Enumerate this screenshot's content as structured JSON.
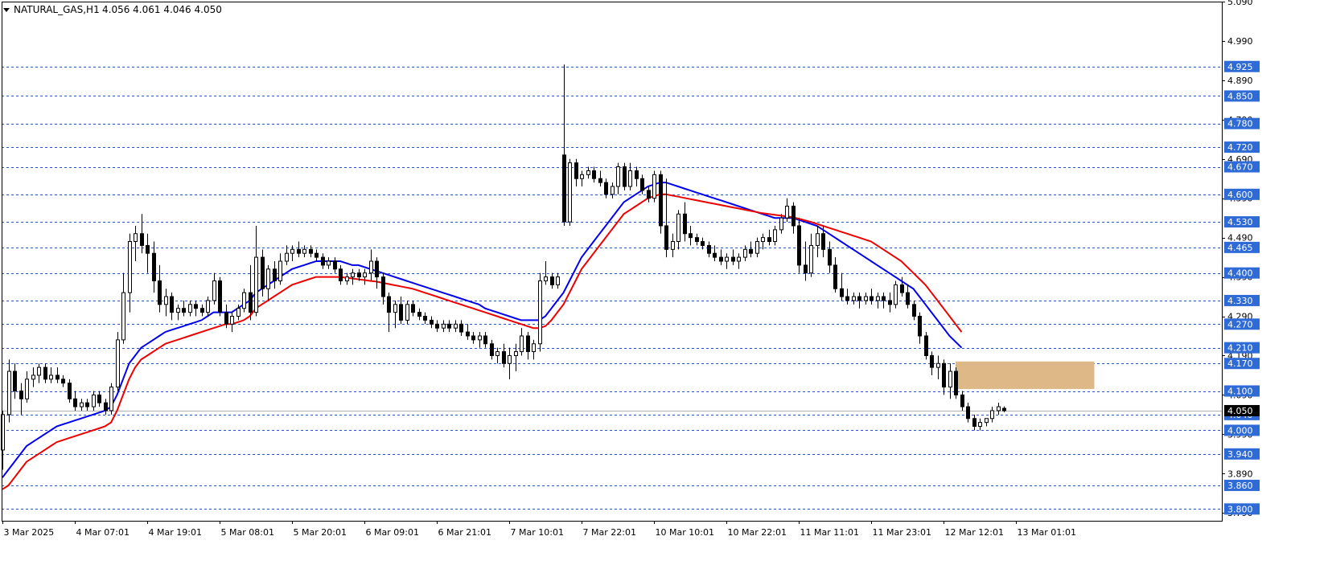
{
  "header": {
    "symbol_info": "NATURAL_GAS,H1",
    "ohlc": "4.056 4.061 4.046 4.050"
  },
  "colors": {
    "ema_fast": "#0000ee",
    "ema_slow": "#ee0000",
    "level_line": "#2e53b8",
    "level_label_bg": "#2e6bd6",
    "zone_fill": "#deb887",
    "current_price_label_bg": "#000000"
  },
  "chart_data": {
    "type": "candlestick",
    "ylim": [
      3.77,
      5.09
    ],
    "y_tick_labels": [
      "5.090",
      "4.990",
      "4.890",
      "4.790",
      "4.690",
      "4.590",
      "4.490",
      "4.390",
      "4.290",
      "4.190",
      "4.090",
      "3.990",
      "3.890",
      "3.790"
    ],
    "x_tick_labels": [
      {
        "bar": 0,
        "label": "3 Mar 2025"
      },
      {
        "bar": 12,
        "label": "4 Mar 07:01"
      },
      {
        "bar": 24,
        "label": "4 Mar 19:01"
      },
      {
        "bar": 36,
        "label": "5 Mar 08:01"
      },
      {
        "bar": 48,
        "label": "5 Mar 20:01"
      },
      {
        "bar": 60,
        "label": "6 Mar 09:01"
      },
      {
        "bar": 72,
        "label": "6 Mar 21:01"
      },
      {
        "bar": 84,
        "label": "7 Mar 10:01"
      },
      {
        "bar": 96,
        "label": "7 Mar 22:01"
      },
      {
        "bar": 108,
        "label": "10 Mar 10:01"
      },
      {
        "bar": 120,
        "label": "10 Mar 22:01"
      },
      {
        "bar": 132,
        "label": "11 Mar 11:01"
      },
      {
        "bar": 144,
        "label": "11 Mar 23:01"
      },
      {
        "bar": 156,
        "label": "12 Mar 12:01"
      },
      {
        "bar": 168,
        "label": "13 Mar 01:01"
      }
    ],
    "horizontal_levels": [
      4.925,
      4.85,
      4.78,
      4.72,
      4.67,
      4.6,
      4.53,
      4.465,
      4.4,
      4.33,
      4.27,
      4.21,
      4.17,
      4.1,
      4.04,
      4.0,
      3.94,
      3.86,
      3.8
    ],
    "current_price": 4.05,
    "current_price_label": "4.050",
    "zone": {
      "price_low": 4.105,
      "price_high": 4.175,
      "bar_start": 158,
      "bar_end": 181
    },
    "ohlc": [
      [
        3.95,
        4.05,
        3.9,
        4.04
      ],
      [
        4.04,
        4.18,
        4.02,
        4.15
      ],
      [
        4.15,
        4.17,
        4.08,
        4.1
      ],
      [
        4.1,
        4.12,
        4.04,
        4.08
      ],
      [
        4.08,
        4.15,
        4.07,
        4.13
      ],
      [
        4.13,
        4.16,
        4.11,
        4.14
      ],
      [
        4.14,
        4.17,
        4.12,
        4.16
      ],
      [
        4.16,
        4.17,
        4.12,
        4.13
      ],
      [
        4.13,
        4.16,
        4.12,
        4.14
      ],
      [
        4.14,
        4.16,
        4.12,
        4.13
      ],
      [
        4.13,
        4.14,
        4.11,
        4.12
      ],
      [
        4.12,
        4.13,
        4.07,
        4.08
      ],
      [
        4.08,
        4.1,
        4.05,
        4.06
      ],
      [
        4.06,
        4.08,
        4.05,
        4.07
      ],
      [
        4.07,
        4.08,
        4.05,
        4.06
      ],
      [
        4.06,
        4.1,
        4.05,
        4.09
      ],
      [
        4.09,
        4.1,
        4.06,
        4.07
      ],
      [
        4.07,
        4.08,
        4.04,
        4.05
      ],
      [
        4.05,
        4.12,
        4.04,
        4.11
      ],
      [
        4.11,
        4.25,
        4.1,
        4.23
      ],
      [
        4.23,
        4.4,
        4.22,
        4.35
      ],
      [
        4.35,
        4.5,
        4.3,
        4.48
      ],
      [
        4.48,
        4.52,
        4.43,
        4.5
      ],
      [
        4.5,
        4.55,
        4.45,
        4.47
      ],
      [
        4.47,
        4.5,
        4.4,
        4.45
      ],
      [
        4.45,
        4.48,
        4.35,
        4.38
      ],
      [
        4.38,
        4.42,
        4.3,
        4.32
      ],
      [
        4.32,
        4.36,
        4.29,
        4.34
      ],
      [
        4.34,
        4.35,
        4.28,
        4.3
      ],
      [
        4.3,
        4.32,
        4.28,
        4.31
      ],
      [
        4.31,
        4.33,
        4.29,
        4.3
      ],
      [
        4.3,
        4.33,
        4.29,
        4.32
      ],
      [
        4.32,
        4.33,
        4.29,
        4.31
      ],
      [
        4.31,
        4.32,
        4.29,
        4.3
      ],
      [
        4.3,
        4.34,
        4.29,
        4.33
      ],
      [
        4.33,
        4.4,
        4.32,
        4.38
      ],
      [
        4.38,
        4.39,
        4.29,
        4.3
      ],
      [
        4.3,
        4.32,
        4.26,
        4.27
      ],
      [
        4.27,
        4.3,
        4.25,
        4.29
      ],
      [
        4.29,
        4.32,
        4.28,
        4.31
      ],
      [
        4.31,
        4.36,
        4.3,
        4.35
      ],
      [
        4.35,
        4.42,
        4.28,
        4.3
      ],
      [
        4.3,
        4.52,
        4.29,
        4.44
      ],
      [
        4.44,
        4.46,
        4.34,
        4.36
      ],
      [
        4.36,
        4.42,
        4.33,
        4.41
      ],
      [
        4.41,
        4.43,
        4.36,
        4.38
      ],
      [
        4.38,
        4.45,
        4.37,
        4.43
      ],
      [
        4.43,
        4.47,
        4.42,
        4.45
      ],
      [
        4.45,
        4.47,
        4.43,
        4.46
      ],
      [
        4.46,
        4.48,
        4.44,
        4.45
      ],
      [
        4.45,
        4.47,
        4.44,
        4.46
      ],
      [
        4.46,
        4.47,
        4.44,
        4.45
      ],
      [
        4.45,
        4.46,
        4.43,
        4.44
      ],
      [
        4.44,
        4.45,
        4.41,
        4.42
      ],
      [
        4.42,
        4.44,
        4.41,
        4.43
      ],
      [
        4.43,
        4.44,
        4.4,
        4.41
      ],
      [
        4.41,
        4.42,
        4.37,
        4.38
      ],
      [
        4.38,
        4.4,
        4.37,
        4.39
      ],
      [
        4.39,
        4.41,
        4.37,
        4.4
      ],
      [
        4.4,
        4.41,
        4.38,
        4.39
      ],
      [
        4.39,
        4.41,
        4.37,
        4.4
      ],
      [
        4.4,
        4.46,
        4.38,
        4.43
      ],
      [
        4.43,
        4.44,
        4.36,
        4.39
      ],
      [
        4.39,
        4.4,
        4.32,
        4.34
      ],
      [
        4.34,
        4.35,
        4.25,
        4.3
      ],
      [
        4.3,
        4.33,
        4.26,
        4.32
      ],
      [
        4.32,
        4.34,
        4.27,
        4.28
      ],
      [
        4.28,
        4.33,
        4.27,
        4.32
      ],
      [
        4.32,
        4.33,
        4.29,
        4.3
      ],
      [
        4.3,
        4.31,
        4.28,
        4.29
      ],
      [
        4.29,
        4.3,
        4.27,
        4.28
      ],
      [
        4.28,
        4.29,
        4.26,
        4.27
      ],
      [
        4.27,
        4.28,
        4.25,
        4.26
      ],
      [
        4.26,
        4.28,
        4.25,
        4.27
      ],
      [
        4.27,
        4.28,
        4.25,
        4.26
      ],
      [
        4.26,
        4.28,
        4.25,
        4.27
      ],
      [
        4.27,
        4.28,
        4.24,
        4.25
      ],
      [
        4.25,
        4.27,
        4.23,
        4.24
      ],
      [
        4.24,
        4.25,
        4.22,
        4.23
      ],
      [
        4.23,
        4.25,
        4.21,
        4.24
      ],
      [
        4.24,
        4.25,
        4.21,
        4.22
      ],
      [
        4.22,
        4.23,
        4.18,
        4.19
      ],
      [
        4.19,
        4.21,
        4.17,
        4.2
      ],
      [
        4.2,
        4.22,
        4.16,
        4.17
      ],
      [
        4.17,
        4.21,
        4.13,
        4.19
      ],
      [
        4.19,
        4.22,
        4.15,
        4.2
      ],
      [
        4.2,
        4.26,
        4.19,
        4.24
      ],
      [
        4.24,
        4.25,
        4.18,
        4.2
      ],
      [
        4.2,
        4.23,
        4.18,
        4.22
      ],
      [
        4.22,
        4.4,
        4.2,
        4.38
      ],
      [
        4.38,
        4.43,
        4.37,
        4.39
      ],
      [
        4.39,
        4.4,
        4.36,
        4.37
      ],
      [
        4.37,
        4.4,
        4.36,
        4.39
      ],
      [
        4.7,
        4.93,
        4.52,
        4.53
      ],
      [
        4.53,
        4.69,
        4.52,
        4.68
      ],
      [
        4.68,
        4.69,
        4.62,
        4.64
      ],
      [
        4.64,
        4.66,
        4.62,
        4.65
      ],
      [
        4.65,
        4.67,
        4.64,
        4.66
      ],
      [
        4.66,
        4.67,
        4.63,
        4.64
      ],
      [
        4.64,
        4.66,
        4.62,
        4.63
      ],
      [
        4.63,
        4.64,
        4.59,
        4.6
      ],
      [
        4.6,
        4.63,
        4.59,
        4.62
      ],
      [
        4.62,
        4.68,
        4.6,
        4.67
      ],
      [
        4.67,
        4.68,
        4.61,
        4.62
      ],
      [
        4.62,
        4.68,
        4.61,
        4.66
      ],
      [
        4.66,
        4.67,
        4.62,
        4.64
      ],
      [
        4.64,
        4.65,
        4.6,
        4.61
      ],
      [
        4.61,
        4.62,
        4.58,
        4.59
      ],
      [
        4.59,
        4.66,
        4.58,
        4.65
      ],
      [
        4.65,
        4.66,
        4.5,
        4.52
      ],
      [
        4.52,
        4.64,
        4.44,
        4.46
      ],
      [
        4.46,
        4.5,
        4.44,
        4.48
      ],
      [
        4.48,
        4.56,
        4.46,
        4.55
      ],
      [
        4.55,
        4.58,
        4.48,
        4.5
      ],
      [
        4.5,
        4.52,
        4.47,
        4.49
      ],
      [
        4.49,
        4.5,
        4.47,
        4.48
      ],
      [
        4.48,
        4.49,
        4.46,
        4.47
      ],
      [
        4.47,
        4.48,
        4.44,
        4.45
      ],
      [
        4.45,
        4.47,
        4.43,
        4.44
      ],
      [
        4.44,
        4.46,
        4.42,
        4.43
      ],
      [
        4.43,
        4.45,
        4.41,
        4.44
      ],
      [
        4.44,
        4.46,
        4.42,
        4.43
      ],
      [
        4.43,
        4.45,
        4.41,
        4.44
      ],
      [
        4.44,
        4.47,
        4.43,
        4.46
      ],
      [
        4.46,
        4.48,
        4.44,
        4.45
      ],
      [
        4.45,
        4.49,
        4.44,
        4.48
      ],
      [
        4.48,
        4.5,
        4.46,
        4.49
      ],
      [
        4.49,
        4.51,
        4.47,
        4.48
      ],
      [
        4.48,
        4.52,
        4.47,
        4.51
      ],
      [
        4.51,
        4.55,
        4.5,
        4.54
      ],
      [
        4.54,
        4.59,
        4.53,
        4.57
      ],
      [
        4.57,
        4.58,
        4.5,
        4.52
      ],
      [
        4.52,
        4.54,
        4.4,
        4.42
      ],
      [
        4.42,
        4.48,
        4.38,
        4.4
      ],
      [
        4.4,
        4.5,
        4.39,
        4.47
      ],
      [
        4.47,
        4.52,
        4.44,
        4.5
      ],
      [
        4.5,
        4.52,
        4.44,
        4.46
      ],
      [
        4.46,
        4.48,
        4.4,
        4.42
      ],
      [
        4.42,
        4.44,
        4.35,
        4.36
      ],
      [
        4.36,
        4.4,
        4.33,
        4.34
      ],
      [
        4.34,
        4.36,
        4.32,
        4.33
      ],
      [
        4.33,
        4.35,
        4.32,
        4.34
      ],
      [
        4.34,
        4.35,
        4.31,
        4.33
      ],
      [
        4.33,
        4.35,
        4.32,
        4.34
      ],
      [
        4.34,
        4.36,
        4.32,
        4.33
      ],
      [
        4.33,
        4.35,
        4.31,
        4.34
      ],
      [
        4.34,
        4.35,
        4.31,
        4.33
      ],
      [
        4.33,
        4.35,
        4.3,
        4.32
      ],
      [
        4.32,
        4.38,
        4.31,
        4.37
      ],
      [
        4.37,
        4.39,
        4.34,
        4.35
      ],
      [
        4.35,
        4.37,
        4.31,
        4.32
      ],
      [
        4.32,
        4.33,
        4.28,
        4.29
      ],
      [
        4.29,
        4.3,
        4.22,
        4.24
      ],
      [
        4.24,
        4.25,
        4.18,
        4.19
      ],
      [
        4.19,
        4.2,
        4.14,
        4.16
      ],
      [
        4.16,
        4.19,
        4.13,
        4.17
      ],
      [
        4.17,
        4.18,
        4.09,
        4.11
      ],
      [
        4.11,
        4.17,
        4.08,
        4.15
      ],
      [
        4.15,
        4.16,
        4.08,
        4.09
      ],
      [
        4.09,
        4.1,
        4.05,
        4.06
      ],
      [
        4.06,
        4.07,
        4.02,
        4.03
      ],
      [
        4.03,
        4.04,
        4.0,
        4.01
      ],
      [
        4.01,
        4.03,
        4.0,
        4.02
      ],
      [
        4.02,
        4.03,
        4.01,
        4.03
      ],
      [
        4.03,
        4.06,
        4.02,
        4.05
      ],
      [
        4.05,
        4.07,
        4.04,
        4.06
      ],
      [
        4.056,
        4.061,
        4.046,
        4.05
      ]
    ],
    "ema_fast": [
      3.88,
      3.9,
      3.92,
      3.94,
      3.96,
      3.97,
      3.98,
      3.99,
      4.0,
      4.01,
      4.015,
      4.02,
      4.025,
      4.03,
      4.035,
      4.04,
      4.045,
      4.05,
      4.06,
      4.09,
      4.13,
      4.17,
      4.19,
      4.21,
      4.22,
      4.23,
      4.24,
      4.25,
      4.255,
      4.26,
      4.265,
      4.27,
      4.275,
      4.28,
      4.29,
      4.3,
      4.3,
      4.3,
      4.3,
      4.31,
      4.32,
      4.33,
      4.35,
      4.36,
      4.37,
      4.38,
      4.39,
      4.4,
      4.41,
      4.415,
      4.42,
      4.425,
      4.43,
      4.43,
      4.43,
      4.43,
      4.43,
      4.425,
      4.42,
      4.42,
      4.415,
      4.41,
      4.405,
      4.4,
      4.395,
      4.39,
      4.385,
      4.38,
      4.375,
      4.37,
      4.365,
      4.36,
      4.355,
      4.35,
      4.345,
      4.34,
      4.335,
      4.33,
      4.325,
      4.32,
      4.31,
      4.305,
      4.3,
      4.295,
      4.29,
      4.285,
      4.28,
      4.28,
      4.28,
      4.28,
      4.29,
      4.31,
      4.33,
      4.35,
      4.38,
      4.41,
      4.44,
      4.46,
      4.48,
      4.5,
      4.52,
      4.54,
      4.56,
      4.58,
      4.59,
      4.6,
      4.61,
      4.62,
      4.625,
      4.63,
      4.63,
      4.625,
      4.62,
      4.615,
      4.61,
      4.605,
      4.6,
      4.595,
      4.59,
      4.585,
      4.58,
      4.575,
      4.57,
      4.565,
      4.56,
      4.555,
      4.55,
      4.545,
      4.54,
      4.54,
      4.54,
      4.54,
      4.535,
      4.53,
      4.525,
      4.52,
      4.51,
      4.5,
      4.49,
      4.48,
      4.47,
      4.46,
      4.45,
      4.44,
      4.43,
      4.42,
      4.41,
      4.4,
      4.39,
      4.38,
      4.37,
      4.36,
      4.34,
      4.32,
      4.3,
      4.28,
      4.26,
      4.24,
      4.225,
      4.21
    ],
    "ema_slow": [
      3.85,
      3.86,
      3.88,
      3.9,
      3.92,
      3.93,
      3.94,
      3.95,
      3.96,
      3.97,
      3.975,
      3.98,
      3.985,
      3.99,
      3.995,
      4.0,
      4.005,
      4.01,
      4.02,
      4.05,
      4.09,
      4.13,
      4.16,
      4.18,
      4.19,
      4.2,
      4.21,
      4.22,
      4.225,
      4.23,
      4.235,
      4.24,
      4.245,
      4.25,
      4.255,
      4.26,
      4.265,
      4.27,
      4.27,
      4.275,
      4.28,
      4.29,
      4.31,
      4.32,
      4.33,
      4.34,
      4.35,
      4.36,
      4.37,
      4.375,
      4.38,
      4.385,
      4.39,
      4.39,
      4.39,
      4.39,
      4.39,
      4.388,
      4.386,
      4.384,
      4.382,
      4.38,
      4.378,
      4.375,
      4.372,
      4.369,
      4.366,
      4.363,
      4.36,
      4.355,
      4.35,
      4.345,
      4.34,
      4.335,
      4.33,
      4.325,
      4.32,
      4.315,
      4.31,
      4.305,
      4.3,
      4.295,
      4.29,
      4.285,
      4.28,
      4.275,
      4.27,
      4.265,
      4.26,
      4.26,
      4.265,
      4.28,
      4.3,
      4.32,
      4.35,
      4.38,
      4.41,
      4.43,
      4.45,
      4.47,
      4.49,
      4.51,
      4.53,
      4.55,
      4.56,
      4.57,
      4.58,
      4.59,
      4.595,
      4.6,
      4.6,
      4.597,
      4.594,
      4.591,
      4.588,
      4.585,
      4.582,
      4.579,
      4.576,
      4.573,
      4.57,
      4.567,
      4.564,
      4.561,
      4.558,
      4.555,
      4.552,
      4.55,
      4.548,
      4.546,
      4.544,
      4.542,
      4.538,
      4.534,
      4.53,
      4.525,
      4.52,
      4.515,
      4.51,
      4.505,
      4.5,
      4.495,
      4.49,
      4.485,
      4.48,
      4.47,
      4.46,
      4.45,
      4.44,
      4.43,
      4.415,
      4.4,
      4.385,
      4.37,
      4.35,
      4.33,
      4.31,
      4.29,
      4.27,
      4.25
    ]
  }
}
